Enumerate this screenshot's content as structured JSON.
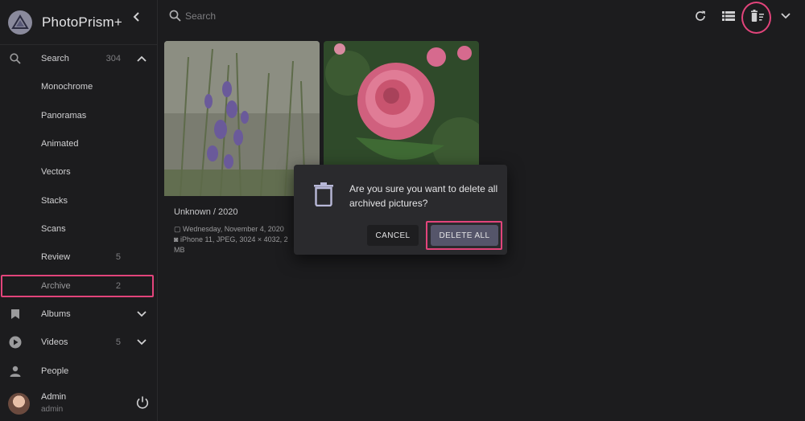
{
  "app": {
    "title": "PhotoPrism+"
  },
  "sidebar": {
    "search": {
      "label": "Search",
      "count": "304"
    },
    "items": [
      {
        "label": "Monochrome"
      },
      {
        "label": "Panoramas"
      },
      {
        "label": "Animated"
      },
      {
        "label": "Vectors"
      },
      {
        "label": "Stacks"
      },
      {
        "label": "Scans"
      },
      {
        "label": "Review",
        "count": "5"
      },
      {
        "label": "Archive",
        "count": "2"
      }
    ],
    "albums": {
      "label": "Albums"
    },
    "videos": {
      "label": "Videos",
      "count": "5"
    },
    "people": {
      "label": "People"
    },
    "user": {
      "name": "Admin",
      "login": "admin"
    }
  },
  "toolbar": {
    "search_placeholder": "Search"
  },
  "cards": [
    {
      "title": "Unknown / 2020",
      "date": "Wednesday, November 4, 2020",
      "camera": "iPhone 11, JPEG, 3024 × 4032, 2",
      "size_unit": "MB"
    }
  ],
  "dialog": {
    "message": "Are you sure you want to delete all archived pictures?",
    "cancel_label": "CANCEL",
    "delete_label": "DELETE ALL"
  },
  "colors": {
    "highlight": "#e2447b",
    "accent_button": "#55556a"
  }
}
